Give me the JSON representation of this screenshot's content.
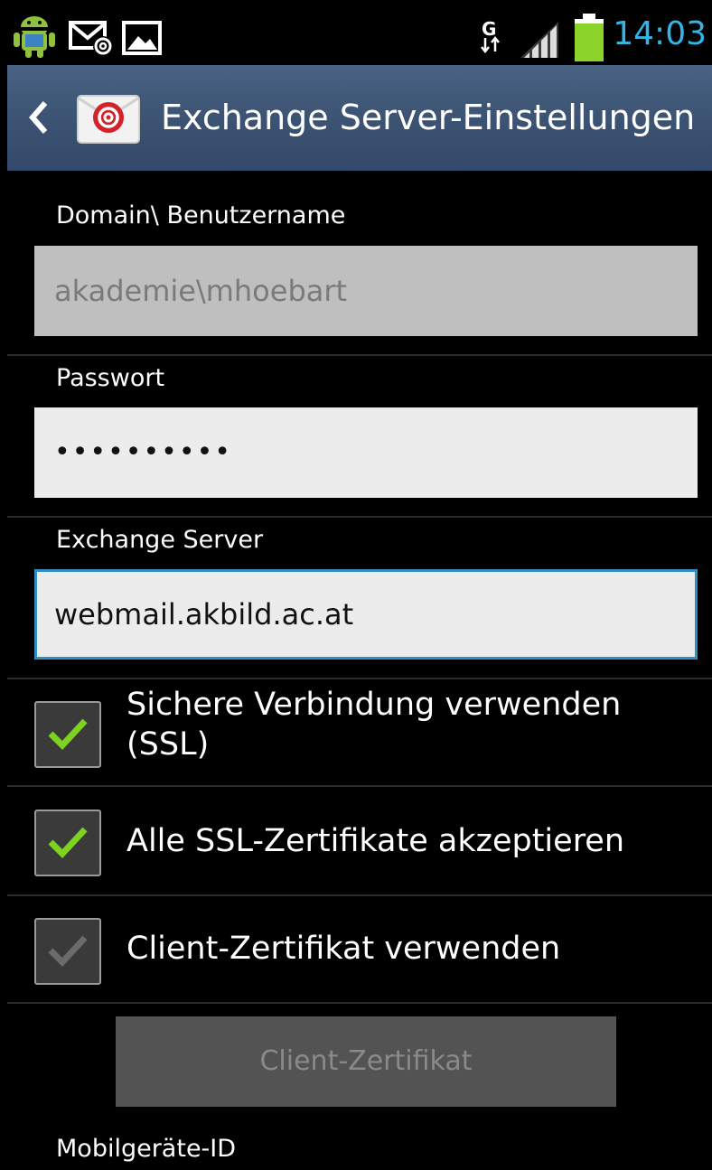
{
  "status_bar": {
    "time": "14:03",
    "network_type": "G",
    "icons": [
      "android-debug-icon",
      "email-notification-icon",
      "image-notification-icon",
      "data-transfer-icon",
      "signal-icon",
      "battery-icon"
    ]
  },
  "action_bar": {
    "title": "Exchange Server-Einstellungen",
    "icons": [
      "back-icon",
      "email-app-icon"
    ]
  },
  "form": {
    "username": {
      "label": "Domain\\ Benutzername",
      "value": "akademie\\mhoebart",
      "enabled": false
    },
    "password": {
      "label": "Passwort",
      "value": "••••••••••"
    },
    "server": {
      "label": "Exchange Server",
      "value": "webmail.akbild.ac.at",
      "focused": true
    }
  },
  "options": {
    "ssl": {
      "label": "Sichere Verbindung verwenden (SSL)",
      "checked": true
    },
    "accept_all": {
      "label": "Alle SSL-Zertifikate akzeptieren",
      "checked": true
    },
    "client_cert": {
      "label": "Client-Zertifikat verwenden",
      "checked": false
    }
  },
  "client_cert_button": {
    "label": "Client-Zertifikat",
    "enabled": false
  },
  "device_id": {
    "label": "Mobilgeräte-ID"
  },
  "colors": {
    "accent": "#33b5e5",
    "check_green": "#7ed321",
    "focus_border": "#2f8fc4",
    "action_bar": "#3f5676"
  }
}
